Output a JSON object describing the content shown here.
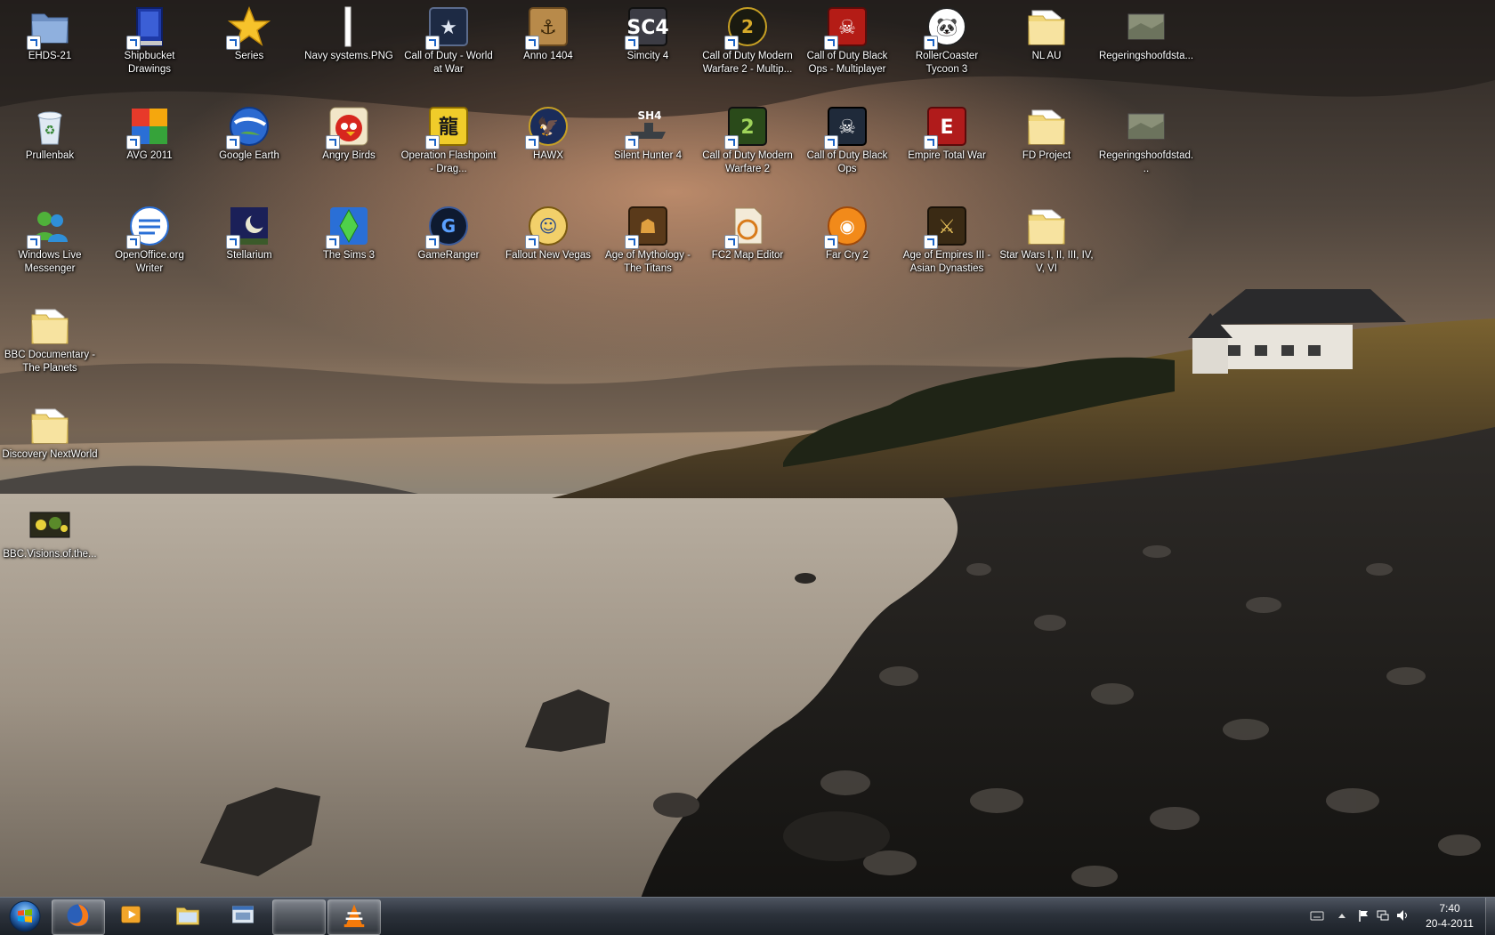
{
  "desktop": {
    "icons": [
      {
        "label": "EHDS-21",
        "icon": "folder-blue-icon",
        "shortcut": true
      },
      {
        "label": "Shipbucket Drawings",
        "icon": "book-icon",
        "shortcut": true
      },
      {
        "label": "Series",
        "icon": "star-icon",
        "shortcut": true
      },
      {
        "label": "Navy systems.PNG",
        "icon": "image-file-icon",
        "shortcut": false
      },
      {
        "label": "Call of Duty - World at War",
        "icon": "cod-waw-icon",
        "shortcut": true
      },
      {
        "label": "Anno 1404",
        "icon": "anno-icon",
        "shortcut": true
      },
      {
        "label": "Simcity 4",
        "icon": "simcity-icon",
        "shortcut": true
      },
      {
        "label": "Call of Duty Modern Warfare 2 - Multip...",
        "icon": "cod-mw2-mp-icon",
        "shortcut": true
      },
      {
        "label": "Call of Duty Black Ops - Multiplayer",
        "icon": "cod-bo-mp-icon",
        "shortcut": true
      },
      {
        "label": "RollerCoaster Tycoon 3",
        "icon": "panda-icon",
        "shortcut": true
      },
      {
        "label": "NL AU",
        "icon": "folder-icon",
        "shortcut": false
      },
      {
        "label": "Regeringshoofdsta...",
        "icon": "map-image-icon",
        "shortcut": false
      },
      {
        "label": "Prullenbak",
        "icon": "recycle-bin-icon",
        "shortcut": false
      },
      {
        "label": "AVG 2011",
        "icon": "avg-icon",
        "shortcut": true
      },
      {
        "label": "Google Earth",
        "icon": "google-earth-icon",
        "shortcut": true
      },
      {
        "label": "Angry Birds",
        "icon": "angry-birds-icon",
        "shortcut": true
      },
      {
        "label": "Operation Flashpoint - Drag...",
        "icon": "dragon-icon",
        "shortcut": true
      },
      {
        "label": "HAWX",
        "icon": "hawx-icon",
        "shortcut": true
      },
      {
        "label": "Silent Hunter 4",
        "icon": "submarine-icon",
        "shortcut": true
      },
      {
        "label": "Call of Duty Modern Warfare 2",
        "icon": "cod-mw2-icon",
        "shortcut": true
      },
      {
        "label": "Call of Duty Black Ops",
        "icon": "cod-bo-icon",
        "shortcut": true
      },
      {
        "label": "Empire Total War",
        "icon": "empire-icon",
        "shortcut": true
      },
      {
        "label": "FD Project",
        "icon": "folder-icon",
        "shortcut": false
      },
      {
        "label": "Regeringshoofdstad...",
        "icon": "map-image-icon",
        "shortcut": false
      },
      {
        "label": "Windows Live Messenger",
        "icon": "messenger-icon",
        "shortcut": true
      },
      {
        "label": "OpenOffice.org Writer",
        "icon": "writer-icon",
        "shortcut": true
      },
      {
        "label": "Stellarium",
        "icon": "stellarium-icon",
        "shortcut": true
      },
      {
        "label": "The Sims 3",
        "icon": "sims-icon",
        "shortcut": true
      },
      {
        "label": "GameRanger",
        "icon": "gameranger-icon",
        "shortcut": true
      },
      {
        "label": "Fallout New Vegas",
        "icon": "vault-boy-icon",
        "shortcut": true
      },
      {
        "label": "Age of Mythology - The Titans",
        "icon": "titan-icon",
        "shortcut": true
      },
      {
        "label": "FC2 Map Editor",
        "icon": "map-editor-icon",
        "shortcut": true
      },
      {
        "label": "Far Cry 2",
        "icon": "farcry-icon",
        "shortcut": true
      },
      {
        "label": "Age of Empires III - Asian Dynasties",
        "icon": "samurai-icon",
        "shortcut": true
      },
      {
        "label": "Star Wars I, II, III, IV, V, VI",
        "icon": "folder-icon",
        "shortcut": false
      },
      {
        "label": "BBC Documentary - The Planets",
        "icon": "folder-icon",
        "shortcut": false
      },
      {
        "label": "Discovery NextWorld",
        "icon": "folder-icon",
        "shortcut": false
      },
      {
        "label": "BBC.Visions.of.the...",
        "icon": "video-thumb-icon",
        "shortcut": false
      }
    ]
  },
  "taskbar": {
    "buttons": [
      {
        "name": "firefox",
        "icon": "firefox-icon",
        "active": true
      },
      {
        "name": "media-player",
        "icon": "media-player-icon",
        "active": false
      },
      {
        "name": "explorer",
        "icon": "explorer-folder-icon",
        "active": false
      },
      {
        "name": "window-switcher",
        "icon": "window-icon",
        "active": false
      },
      {
        "name": "messenger",
        "icon": "messenger-icon",
        "active": true
      },
      {
        "name": "vlc",
        "icon": "vlc-icon",
        "active": true
      }
    ],
    "clock": {
      "time": "7:40",
      "date": "20-4-2011"
    }
  },
  "colors": {
    "taskbar": "#2c323b",
    "label_text": "#ffffff"
  }
}
